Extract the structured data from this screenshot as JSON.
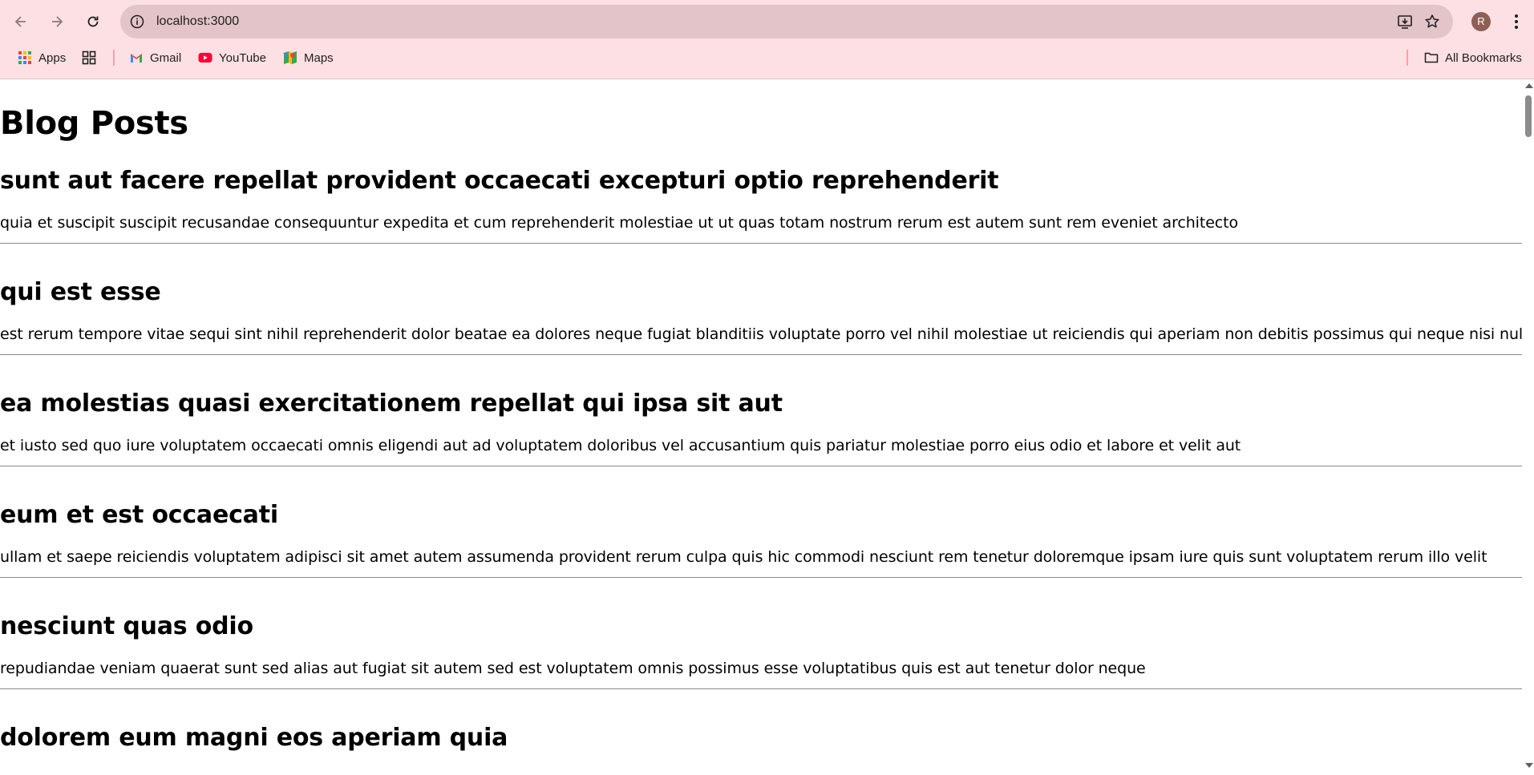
{
  "browser": {
    "url": "localhost:3000",
    "avatar_letter": "R",
    "bookmarks": {
      "apps": "Apps",
      "gmail": "Gmail",
      "youtube": "YouTube",
      "maps": "Maps",
      "all_bookmarks": "All Bookmarks"
    },
    "icons": [
      "back-icon",
      "forward-icon",
      "reload-icon",
      "site-info-icon",
      "install-icon",
      "star-icon",
      "more-icon",
      "apps-grid-icon",
      "tab-groups-icon",
      "gmail-icon",
      "youtube-icon",
      "maps-icon",
      "folder-icon"
    ],
    "colors": {
      "chrome_bg": "#fde0e3",
      "omnibox_bg": "#e3c4c9",
      "avatar_bg": "#8f5f55"
    }
  },
  "page": {
    "title": "Blog Posts",
    "posts": [
      {
        "title": "sunt aut facere repellat provident occaecati excepturi optio reprehenderit",
        "body": "quia et suscipit suscipit recusandae consequuntur expedita et cum reprehenderit molestiae ut ut quas totam nostrum rerum est autem sunt rem eveniet architecto"
      },
      {
        "title": "qui est esse",
        "body": "est rerum tempore vitae sequi sint nihil reprehenderit dolor beatae ea dolores neque fugiat blanditiis voluptate porro vel nihil molestiae ut reiciendis qui aperiam non debitis possimus qui neque nisi nulla"
      },
      {
        "title": "ea molestias quasi exercitationem repellat qui ipsa sit aut",
        "body": "et iusto sed quo iure voluptatem occaecati omnis eligendi aut ad voluptatem doloribus vel accusantium quis pariatur molestiae porro eius odio et labore et velit aut"
      },
      {
        "title": "eum et est occaecati",
        "body": "ullam et saepe reiciendis voluptatem adipisci sit amet autem assumenda provident rerum culpa quis hic commodi nesciunt rem tenetur doloremque ipsam iure quis sunt voluptatem rerum illo velit"
      },
      {
        "title": "nesciunt quas odio",
        "body": "repudiandae veniam quaerat sunt sed alias aut fugiat sit autem sed est voluptatem omnis possimus esse voluptatibus quis est aut tenetur dolor neque"
      },
      {
        "title": "dolorem eum magni eos aperiam quia",
        "body": ""
      }
    ]
  }
}
